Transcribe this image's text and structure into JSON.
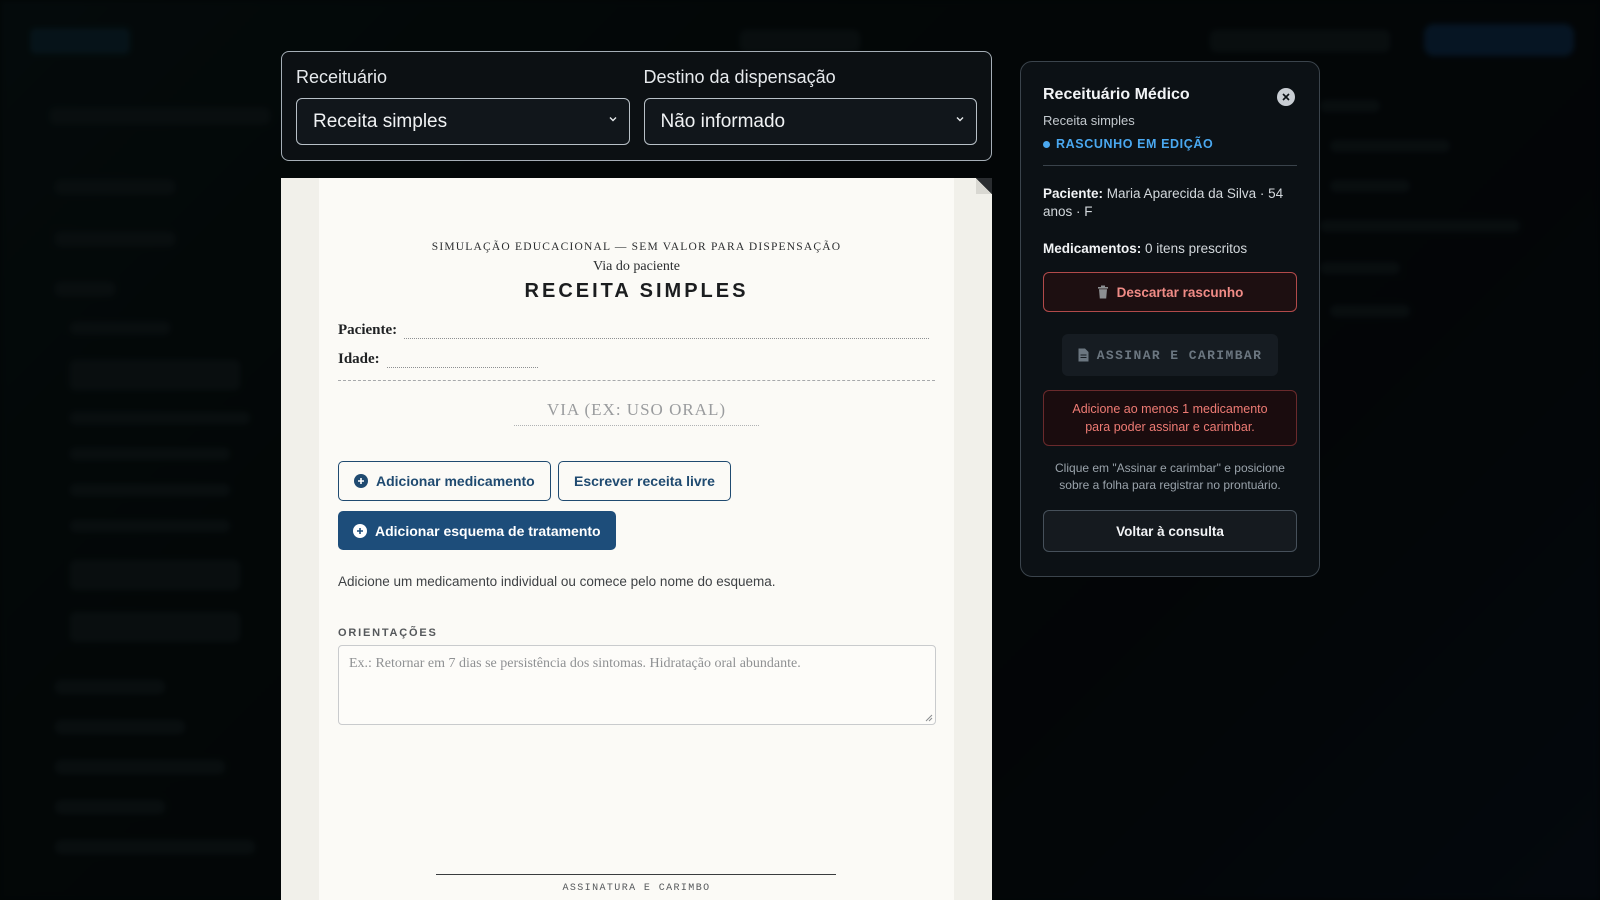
{
  "selectors": {
    "receituario_label": "Receituário",
    "receituario_value": "Receita simples",
    "destino_label": "Destino da dispensação",
    "destino_value": "Não informado"
  },
  "paper": {
    "notice": "SIMULAÇÃO EDUCACIONAL — SEM VALOR PARA DISPENSAÇÃO",
    "via": "Via do paciente",
    "title": "RECEITA SIMPLES",
    "patient_label": "Paciente:",
    "age_label": "Idade:",
    "via_placeholder": "VIA (EX: USO ORAL)",
    "add_med_button": "Adicionar medicamento",
    "free_text_button": "Escrever receita livre",
    "add_scheme_button": "Adicionar esquema de tratamento",
    "hint": "Adicione um medicamento individual ou comece pelo nome do esquema.",
    "orientations_label": "ORIENTAÇÕES",
    "orientations_placeholder": "Ex.: Retornar em 7 dias se persistência dos sintomas. Hidratação oral abundante.",
    "signature_label": "ASSINATURA E CARIMBO"
  },
  "panel": {
    "title": "Receituário Médico",
    "subtitle": "Receita simples",
    "status": "RASCUNHO EM EDIÇÃO",
    "patient_label": "Paciente:",
    "patient_value": "Maria Aparecida da Silva · 54 anos · F",
    "meds_label": "Medicamentos:",
    "meds_value": "0 itens prescritos",
    "discard_button": "Descartar rascunho",
    "sign_button": "ASSINAR E CARIMBAR",
    "warning": "Adicione ao menos 1 medicamento para poder assinar e carimbar.",
    "help": "Clique em \"Assinar e carimbar\" e posicione sobre a folha para registrar no prontuário.",
    "back_button": "Voltar à consulta"
  },
  "icons": {
    "chevron": "chevron-down-icon",
    "plus": "plus-circle-icon",
    "close": "close-icon",
    "trash": "trash-icon",
    "document": "document-icon"
  },
  "colors": {
    "accent_blue": "#1d4d7a",
    "status_blue": "#4aa8f0",
    "danger": "#f08b86"
  }
}
